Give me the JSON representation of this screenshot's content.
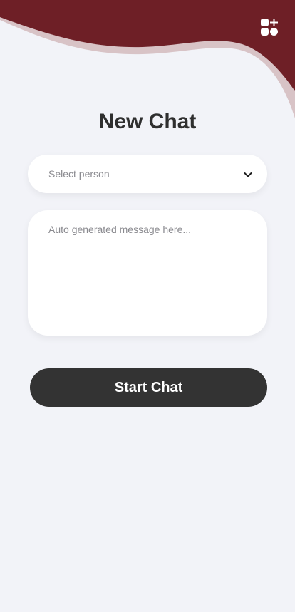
{
  "header": {
    "apps_icon": "apps-plus-icon",
    "accent_color": "#6e1f26",
    "wave_light_color": "#d8c3c6"
  },
  "page": {
    "title": "New Chat"
  },
  "person_select": {
    "selected_value": "Select person",
    "icon": "chevron-down-icon"
  },
  "message": {
    "placeholder": "Auto generated message here...",
    "value": ""
  },
  "actions": {
    "start_chat_label": "Start Chat",
    "button_color": "#333333"
  }
}
